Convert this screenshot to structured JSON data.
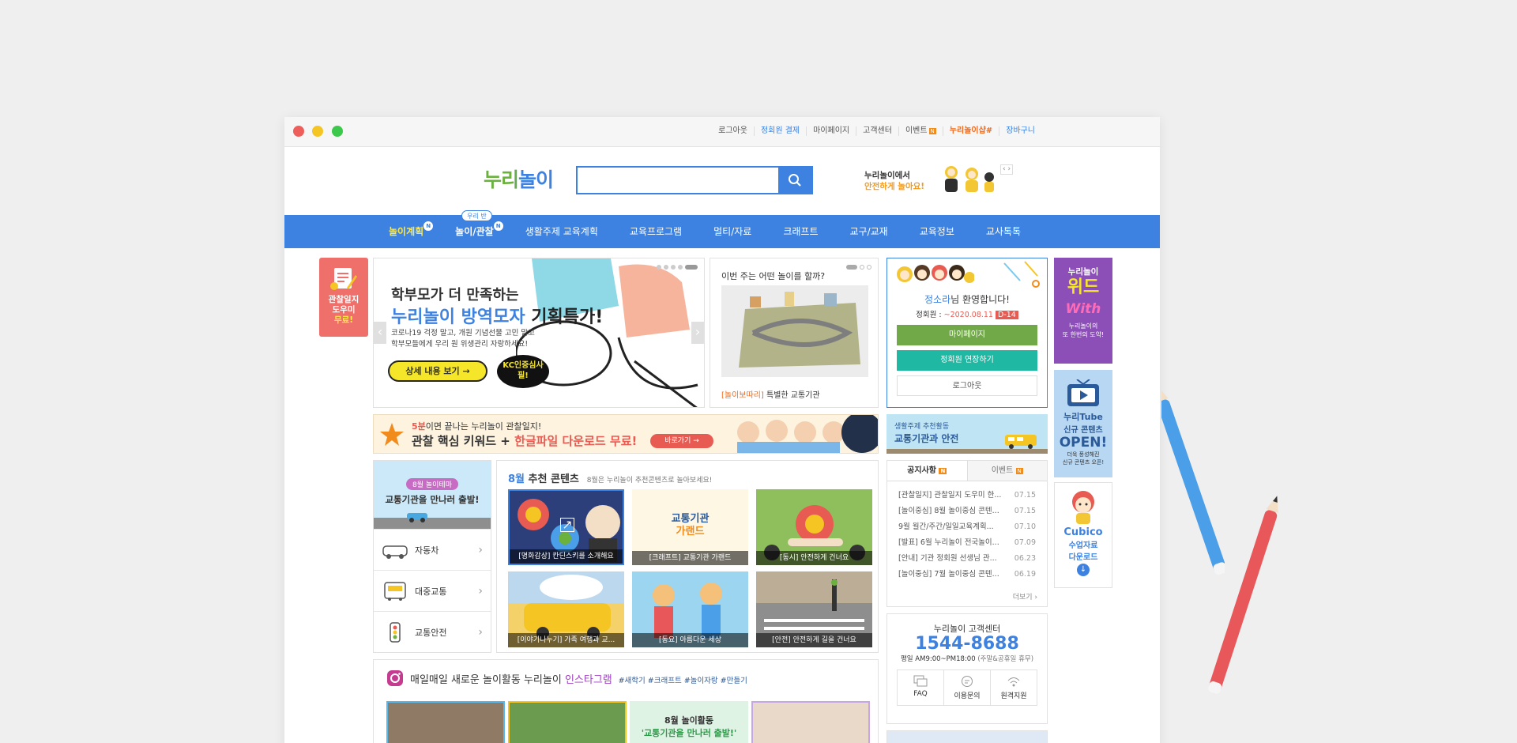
{
  "topbar": {
    "logout": "로그아웃",
    "payment": "정회원 결제",
    "mypage": "마이페이지",
    "customer": "고객센터",
    "event": "이벤트",
    "event_badge": "N",
    "nuri_hash": "누리놀이샵#",
    "cart": "장바구니"
  },
  "header": {
    "logo": "누리놀이",
    "search_placeholder": "",
    "promo_line1": "누리놀이에서",
    "promo_line2": "안전하게 놀아요!",
    "promo_nav": "‹ ›"
  },
  "nav": {
    "items": [
      {
        "label": "놀이계획",
        "badge": "N"
      },
      {
        "label": "놀이/관찰",
        "badge": "N",
        "tag": "우리 반"
      },
      {
        "label": "생활주제 교육계획"
      },
      {
        "label": "교육프로그램"
      },
      {
        "label": "멀티/자료"
      },
      {
        "label": "크래프트"
      },
      {
        "label": "교구/교재"
      },
      {
        "label": "교육정보"
      },
      {
        "label": "교사톡톡"
      }
    ]
  },
  "side_left": {
    "line1": "관찰일지",
    "line2": "도우미",
    "line3": "무료!",
    "badge": "free"
  },
  "hero": {
    "headline1": "학부모가 더 만족하는",
    "headline2": "누리놀이 방역모자",
    "headline3": "기획특가!",
    "desc1": "코로나19 걱정 말고, 개원 기념선물 고민 말고",
    "desc2": "학부모들에게 우리 원 위생관리 자랑하세요!",
    "cta": "상세 내용 보기",
    "kc1": "KC인증심사",
    "kc2": "필!",
    "prev": "‹",
    "next": "›"
  },
  "today": {
    "title": "이번 주는 어떤 놀이를 할까?",
    "tag": "[놀이보따리]",
    "caption": "특별한 교통기관"
  },
  "login": {
    "user": "정소라",
    "welcome": "님 환영합니다!",
    "member_label": "정회원 :",
    "member_date": "~2020.08.11",
    "dday": "D-14",
    "btn_mypage": "마이페이지",
    "btn_extend": "정회원 연장하기",
    "btn_logout": "로그아웃"
  },
  "right_banners": {
    "b1_top": "누리놀이",
    "b1_main": "위드",
    "b1_logo": "With",
    "b1_sub1": "누리놀이의",
    "b1_sub2": "또 한번의 도약!",
    "b2_title": "누리Tube",
    "b2_line1": "신규 콘텐츠",
    "b2_line2": "OPEN!",
    "b2_sub1": "더욱 풍성해진",
    "b2_sub2": "신규 콘텐츠 오픈!",
    "b3_logo": "Cubico",
    "b3_line1": "수업자료",
    "b3_line2": "다운로드"
  },
  "strip": {
    "top_a": "5분",
    "top_b": "이면 끝나는 누리놀이 관찰일지!",
    "main_a": "관찰 핵심 키워드 + ",
    "main_b": "한글파일 다운로드 무료!",
    "go": "바로가기"
  },
  "side_mini": {
    "line1": "생활주제 추천활동",
    "line2": "교통기관과 안전"
  },
  "theme": {
    "badge": "8월 놀이테마",
    "title": "교통기관을 만나러 출발!",
    "items": [
      "자동차",
      "대중교통",
      "교통안전"
    ]
  },
  "recommend": {
    "month": "8월",
    "title": " 추천 콘텐츠",
    "sub": "8월은 누리놀이 추천콘텐츠로 놀아보세요!",
    "items": [
      "[명화감상] 칸딘스키를 소개해요",
      "[크래프트] 교통기관 가랜드",
      "[동시] 안전하게 건너요",
      "[이야기나누기] 가족 여행과 교...",
      "[동요] 아름다운 세상",
      "[안전] 안전하게 길을 건너요"
    ],
    "thumb_title1": "교통기관",
    "thumb_title2": "가랜드"
  },
  "notice": {
    "tab1": "공지사항",
    "tab2": "이벤트",
    "rows": [
      {
        "t": "[관찰일지] 관찰일지 도우미 한...",
        "d": "07.15"
      },
      {
        "t": "[놀이중심] 8월 놀이중심 콘텐...",
        "d": "07.15"
      },
      {
        "t": "9월 월간/주간/일일교육계획...",
        "d": "07.10"
      },
      {
        "t": "[발표] 6월 누리놀이 전국놀이...",
        "d": "07.09"
      },
      {
        "t": "[안내] 기관 정회원 선생님 관...",
        "d": "06.23"
      },
      {
        "t": "[놀이중심] 7월 놀이중심 콘텐...",
        "d": "06.19"
      }
    ],
    "more": "더보기 ›"
  },
  "cs": {
    "title": "누리놀이 고객센터",
    "phone": "1544-8688",
    "hours": "평일 AM9:00~PM18:00",
    "hours_note": "(주말&공휴일 휴무)",
    "btns": [
      "FAQ",
      "이용문의",
      "원격지원"
    ]
  },
  "insta": {
    "pre": "매일매일 새로운 놀이활동 누리놀이 ",
    "brand": "인스타그램",
    "tags": "#새학기 #크래프트 #놀이자랑 #만들기",
    "card3_line1": "8월 놀이활동",
    "card3_line2": "'교통기관을 만나러 출발!'"
  },
  "colors": {
    "nav": "#3d82e0",
    "green": "#72a948",
    "teal": "#1fb8a3",
    "orange": "#f08b1c",
    "red": "#e85b52"
  }
}
